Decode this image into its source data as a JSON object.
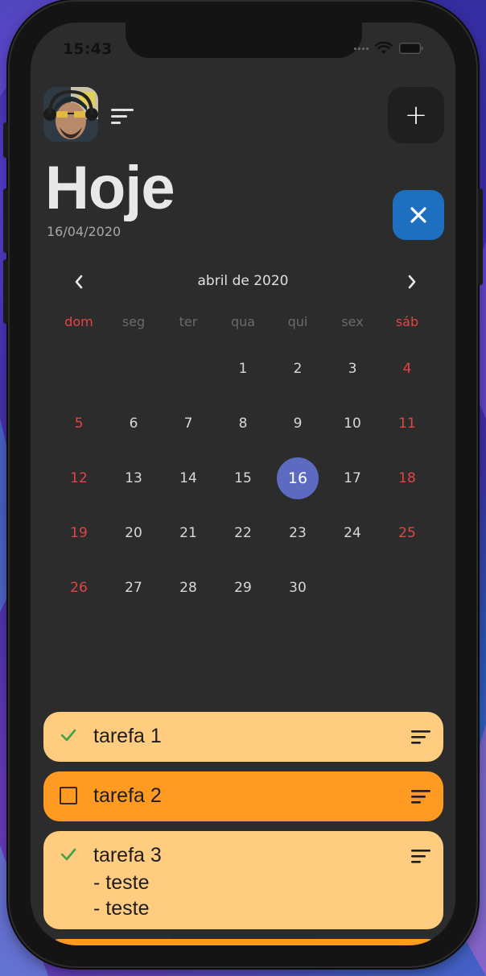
{
  "status_bar": {
    "time": "15:43"
  },
  "header": {
    "add_label": "+",
    "title": "Hoje",
    "date": "16/04/2020"
  },
  "calendar": {
    "month_label": "abril de 2020",
    "weekdays": [
      "dom",
      "seg",
      "ter",
      "qua",
      "qui",
      "sex",
      "sáb"
    ],
    "first_weekday_index": 3,
    "days_in_month": 30,
    "selected_day": 16
  },
  "tasks": [
    {
      "title": "tarefa 1",
      "body": "",
      "done": true
    },
    {
      "title": "tarefa 2",
      "body": "",
      "done": false
    },
    {
      "title": "tarefa 3",
      "body": "- teste\n- teste",
      "done": true
    }
  ],
  "colors": {
    "screen_bg": "#2c2c2c",
    "weekend": "#e04646",
    "selected_day": "#5c6bc0",
    "close_button": "#1e6fc0",
    "task_done": "#ffcc80",
    "task_todo": "#ff9a22",
    "check": "#43a047"
  },
  "icons": {
    "avatar": "user-avatar",
    "menu": "sort-lines-icon",
    "add": "plus-icon",
    "close": "close-icon",
    "prev": "chevron-left-icon",
    "next": "chevron-right-icon",
    "check": "check-icon",
    "unchecked": "checkbox-icon",
    "task_menu": "sort-lines-icon"
  }
}
